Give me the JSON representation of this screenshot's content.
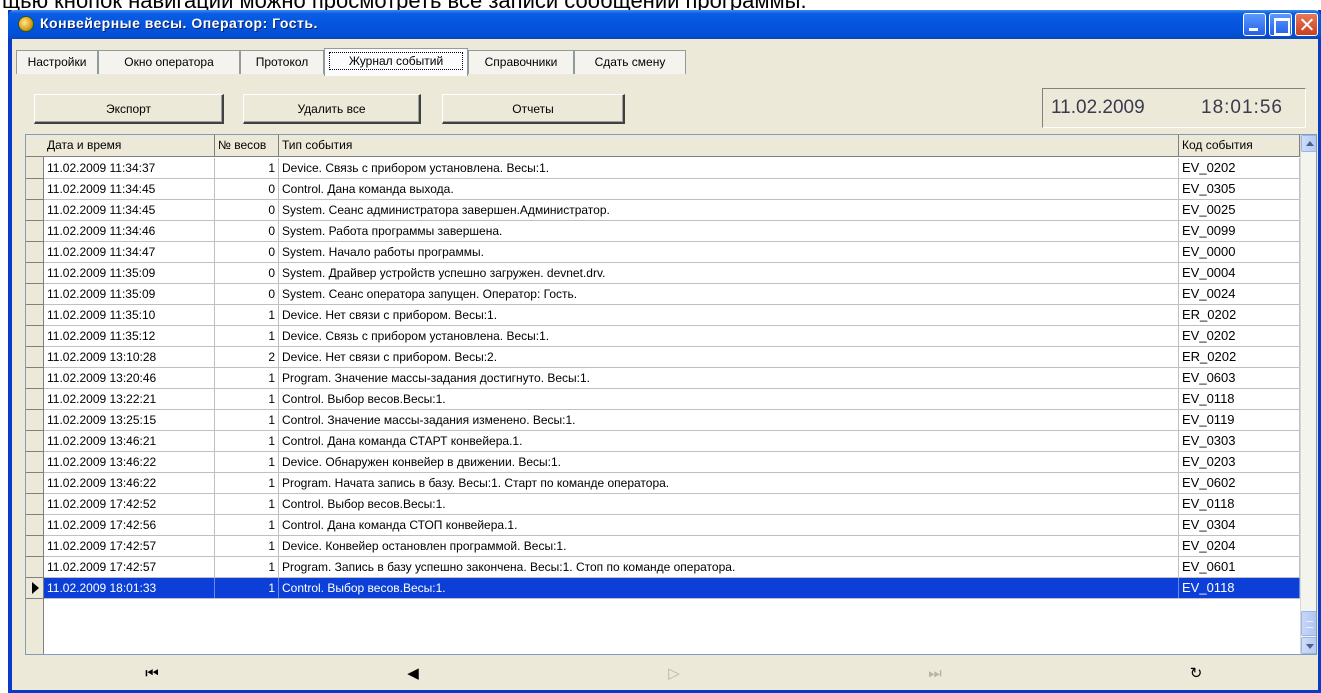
{
  "doc_text": "щью кнопок навигации можно просмотреть все записи сообщений программы.",
  "window": {
    "title": "Конвейерные весы. Оператор: Гость.",
    "controls": {
      "minimize": "minimize-icon",
      "maximize": "maximize-icon",
      "close": "close-icon"
    }
  },
  "tabs": [
    {
      "label": "Настройки",
      "active": false
    },
    {
      "label": "Окно оператора",
      "active": false
    },
    {
      "label": "Протокол",
      "active": false
    },
    {
      "label": "Журнал событий",
      "active": true
    },
    {
      "label": "Справочники",
      "active": false
    },
    {
      "label": "Сдать смену",
      "active": false
    }
  ],
  "toolbar": {
    "export_label": "Экспорт",
    "delete_all_label": "Удалить все",
    "reports_label": "Отчеты"
  },
  "datetime": {
    "date": "11.02.2009",
    "time": "18:01:56"
  },
  "grid": {
    "columns": [
      "Дата и время",
      "№ весов",
      "Тип события",
      "Код события"
    ],
    "rows": [
      [
        "11.02.2009 11:34:37",
        "1",
        "Device. Связь с прибором установлена. Весы:1.",
        "EV_0202"
      ],
      [
        "11.02.2009 11:34:45",
        "0",
        "Control. Дана команда выхода.",
        "EV_0305"
      ],
      [
        "11.02.2009 11:34:45",
        "0",
        "System. Сеанс администратора завершен.Администратор.",
        "EV_0025"
      ],
      [
        "11.02.2009 11:34:46",
        "0",
        "System. Работа программы завершена.",
        "EV_0099"
      ],
      [
        "11.02.2009 11:34:47",
        "0",
        "System. Начало работы программы.",
        "EV_0000"
      ],
      [
        "11.02.2009 11:35:09",
        "0",
        "System. Драйвер устройств успешно загружен. devnet.drv.",
        "EV_0004"
      ],
      [
        "11.02.2009 11:35:09",
        "0",
        "System. Сеанс оператора запущен. Оператор: Гость.",
        "EV_0024"
      ],
      [
        "11.02.2009 11:35:10",
        "1",
        "Device. Нет связи с прибором. Весы:1.",
        "ER_0202"
      ],
      [
        "11.02.2009 11:35:12",
        "1",
        "Device. Связь с прибором установлена. Весы:1.",
        "EV_0202"
      ],
      [
        "11.02.2009 13:10:28",
        "2",
        "Device. Нет связи с прибором. Весы:2.",
        "ER_0202"
      ],
      [
        "11.02.2009 13:20:46",
        "1",
        "Program. Значение массы-задания достигнуто. Весы:1.",
        "EV_0603"
      ],
      [
        "11.02.2009 13:22:21",
        "1",
        "Control. Выбор весов.Весы:1.",
        "EV_0118"
      ],
      [
        "11.02.2009 13:25:15",
        "1",
        "Control. Значение массы-задания изменено. Весы:1.",
        "EV_0119"
      ],
      [
        "11.02.2009 13:46:21",
        "1",
        "Control. Дана команда СТАРТ конвейера.1.",
        "EV_0303"
      ],
      [
        "11.02.2009 13:46:22",
        "1",
        "Device. Обнаружен конвейер в движении. Весы:1.",
        "EV_0203"
      ],
      [
        "11.02.2009 13:46:22",
        "1",
        "Program. Начата запись в базу. Весы:1. Старт по команде оператора.",
        "EV_0602"
      ],
      [
        "11.02.2009 17:42:52",
        "1",
        "Control. Выбор весов.Весы:1.",
        "EV_0118"
      ],
      [
        "11.02.2009 17:42:56",
        "1",
        "Control. Дана команда СТОП конвейера.1.",
        "EV_0304"
      ],
      [
        "11.02.2009 17:42:57",
        "1",
        "Device. Конвейер остановлен программой. Весы:1.",
        "EV_0204"
      ],
      [
        "11.02.2009 17:42:57",
        "1",
        "Program. Запись в базу успешно закончена. Весы:1. Стоп по команде оператора.",
        "EV_0601"
      ],
      [
        "11.02.2009 18:01:33",
        "1",
        "Control. Выбор весов.Весы:1.",
        "EV_0118"
      ]
    ],
    "selected_row": 20
  },
  "navigator": [
    {
      "icon": "first-record-icon",
      "glyph": "⏮",
      "enabled": true
    },
    {
      "icon": "prior-record-icon",
      "glyph": "◀",
      "enabled": true
    },
    {
      "icon": "next-record-icon",
      "glyph": "▷",
      "enabled": false
    },
    {
      "icon": "last-record-icon",
      "glyph": "⏭",
      "enabled": false
    },
    {
      "icon": "refresh-icon",
      "glyph": "↻",
      "enabled": true
    }
  ],
  "colors": {
    "titlebar": "#0454e0",
    "selection": "#0b3fd8",
    "window_bg": "#ece9d8"
  }
}
